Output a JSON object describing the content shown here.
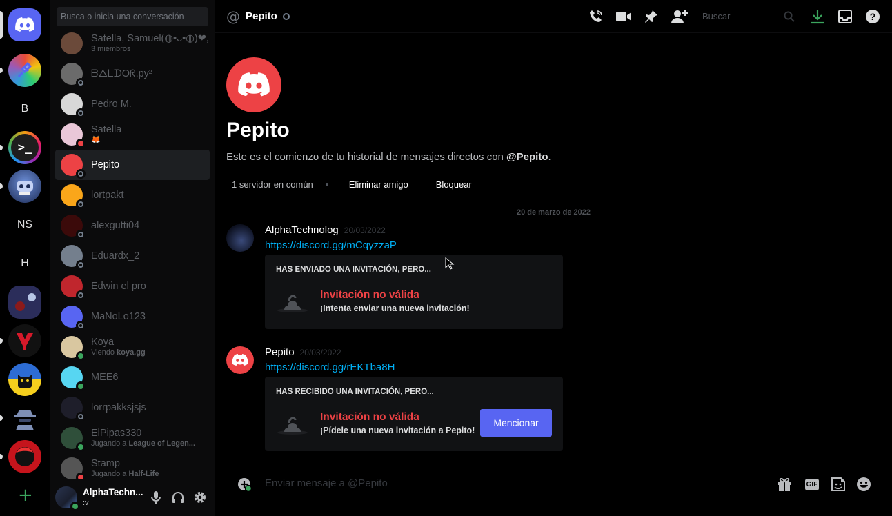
{
  "colors": {
    "brand": "#5865f2",
    "danger": "#ed4245",
    "link": "#00aff4",
    "online": "#3ba55d"
  },
  "rail": {
    "servers": [
      {
        "name": "home-button",
        "label": "",
        "icon": "discord-logo-icon"
      },
      {
        "name": "server-plug",
        "label": "",
        "icon": "plug-icon"
      },
      {
        "name": "server-b",
        "label": "B"
      },
      {
        "name": "server-terminal",
        "label": "",
        "icon": "terminal-icon"
      },
      {
        "name": "server-robot",
        "label": "",
        "icon": "robot-icon"
      },
      {
        "name": "server-ns",
        "label": "NS"
      },
      {
        "name": "server-h",
        "label": "H"
      },
      {
        "name": "server-art",
        "label": "",
        "icon": "art-icon"
      },
      {
        "name": "server-y",
        "label": "",
        "icon": "y-logo-icon"
      },
      {
        "name": "server-cat",
        "label": "",
        "icon": "cat-icon"
      },
      {
        "name": "server-spy",
        "label": "",
        "icon": "spy-icon"
      },
      {
        "name": "server-red",
        "label": "",
        "icon": "red-avatar-icon"
      }
    ],
    "add_label": "+"
  },
  "dm_search": {
    "placeholder": "Busca o inicia una conversación"
  },
  "dms": [
    {
      "name": "Satella, Samuel(◍•ᴗ•◍)❤, ...",
      "sub": "3 miembros",
      "status": "none"
    },
    {
      "name": "ᗷᐃᒪᗪOᖇ.py²",
      "sub": "",
      "status": "offline"
    },
    {
      "name": "Pedro M.",
      "sub": "",
      "status": "offline"
    },
    {
      "name": "Satella",
      "sub": "🦊",
      "status": "dnd"
    },
    {
      "name": "Pepito",
      "sub": "",
      "status": "offline",
      "selected": true
    },
    {
      "name": "lortpakt",
      "sub": "",
      "status": "offline"
    },
    {
      "name": "alexgutti04",
      "sub": "",
      "status": "offline"
    },
    {
      "name": "Eduardx_2",
      "sub": "",
      "status": "offline"
    },
    {
      "name": "Edwin el pro",
      "sub": "",
      "status": "offline"
    },
    {
      "name": "MaNoLo123",
      "sub": "",
      "status": "offline"
    },
    {
      "name": "Koya",
      "sub_pre": "Viendo ",
      "sub_bold": "koya.gg",
      "status": "online"
    },
    {
      "name": "MEE6",
      "sub": "",
      "status": "online"
    },
    {
      "name": "lorrpakksjsjs",
      "sub": "",
      "status": "offline"
    },
    {
      "name": "ElPipas330",
      "sub_pre": "Jugando a ",
      "sub_bold": "League of Legen...",
      "status": "online"
    },
    {
      "name": "Stamp",
      "sub_pre": "Jugando a ",
      "sub_bold": "Half-Life",
      "status": "dnd"
    }
  ],
  "user": {
    "name": "AlphaTechn...",
    "status_text": ":v"
  },
  "topbar": {
    "at": "@",
    "title": "Pepito",
    "search_placeholder": "Buscar"
  },
  "welcome": {
    "name": "Pepito",
    "text_pre": "Este es el comienzo de tu historial de mensajes directos con ",
    "text_user": "@Pepito",
    "text_post": ".",
    "mutual": "1 servidor en común",
    "remove_friend": "Eliminar amigo",
    "block": "Bloquear"
  },
  "divider": "20 de marzo de 2022",
  "messages": [
    {
      "author": "AlphaTechnolog",
      "timestamp": "20/03/2022",
      "link": "https://discord.gg/mCqyzzaP",
      "invite_header": "HAS ENVIADO UNA INVITACIÓN, PERO...",
      "invite_title": "Invitación no válida",
      "invite_sub": "¡Intenta enviar una nueva invitación!"
    },
    {
      "author": "Pepito",
      "timestamp": "20/03/2022",
      "link": "https://discord.gg/rEKTba8H",
      "invite_header": "HAS RECIBIDO UNA INVITACIÓN, PERO...",
      "invite_title": "Invitación no válida",
      "invite_sub": "¡Pídele una nueva invitación a Pepito!",
      "button": "Mencionar"
    }
  ],
  "composer": {
    "placeholder": "Enviar mensaje a @Pepito",
    "gif": "GIF"
  }
}
